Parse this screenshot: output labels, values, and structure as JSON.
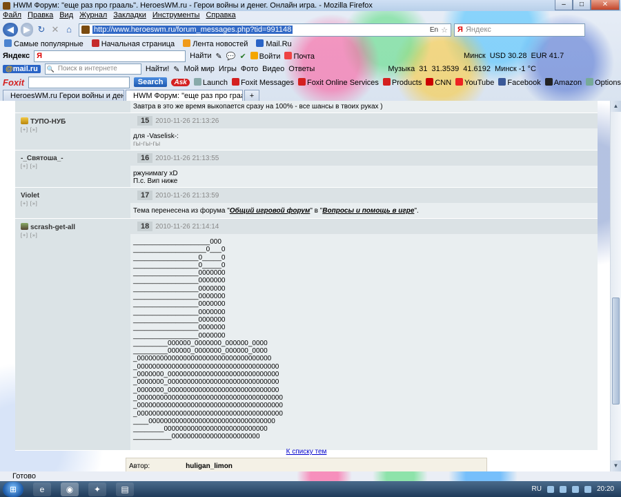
{
  "window": {
    "title": "HWM Форум: \"еще раз про грааль\". HeroesWM.ru - Герои войны и денег. Онлайн игра. - Mozilla Firefox",
    "min": "‒",
    "max": "□",
    "close": "✕"
  },
  "menu": [
    "Файл",
    "Правка",
    "Вид",
    "Журнал",
    "Закладки",
    "Инструменты",
    "Справка"
  ],
  "nav": {
    "url": "http://www.heroeswm.ru/forum_messages.php?tid=991148",
    "lang": "En",
    "search_placeholder": "Яндекс",
    "search_logo": "Я"
  },
  "bookmarks": [
    "Самые популярные",
    "Начальная страница",
    "Лента новостей",
    "Mail.Ru"
  ],
  "yandex_bar": {
    "brand": "Яндекс",
    "input_logo": "Я",
    "find": "Найти",
    "login": "Войти",
    "mail": "Почта",
    "city": "Минск",
    "usd": "USD 30.28",
    "eur": "EUR 41.7"
  },
  "mail_bar": {
    "brand_a": "@",
    "brand_b": "mail.ru",
    "search_placeholder": "Поиск в интернете",
    "find": "Найти!",
    "items": [
      "Мой мир",
      "Игры",
      "Фото",
      "Видео",
      "Ответы"
    ],
    "music": "Музыка",
    "count": "31",
    "rate1": "31.3539",
    "rate2": "41.6192",
    "weather": "Минск -1 °C"
  },
  "foxit_bar": {
    "brand": "Foxit",
    "search": "Search",
    "ask": "Ask",
    "items": [
      "Launch",
      "Foxit Messages",
      "Foxit Online Services",
      "Products",
      "CNN",
      "YouTube",
      "Facebook",
      "Amazon",
      "Options"
    ]
  },
  "tabs": [
    {
      "label": "HeroesWM.ru Герои войны и дене..."
    },
    {
      "label": "HWM Форум: \"еще раз про грааль\" ..."
    }
  ],
  "forum": {
    "prev_tail": "Завтра в это же время выкопается сразу на 100% - все шансы в твоих руках )",
    "author_links": "[+] [»]",
    "posts": [
      {
        "author": "ТУПО-НУБ",
        "num": "15",
        "time": "2010-11-26 21:13:26",
        "lines": [
          "для -Vaselisk-:"
        ],
        "quote": "гы-гы-гы"
      },
      {
        "author": "-_Святоша_-",
        "num": "16",
        "time": "2010-11-26 21:13:55",
        "lines": [
          "ржунимагу xD",
          "П.с. Вип ниже"
        ]
      },
      {
        "author": "Violet",
        "num": "17",
        "time": "2010-11-26 21:13:59",
        "moved_a": "Тема перенесена из форума \"",
        "moved_link1": "Общий игровой форум",
        "moved_b": "\" в \"",
        "moved_link2": "Вопросы и помощь в игре",
        "moved_c": "\"."
      },
      {
        "author": "scrash-get-all",
        "num": "18",
        "time": "2010-11-26 21:14:14",
        "art": [
          "____________________000",
          "___________________0___0",
          "_________________0_____0",
          "_________________0_____0",
          "_________________0000000",
          "_________________0000000",
          "_________________0000000",
          "_________________0000000",
          "_________________0000000",
          "_________________0000000",
          "_________________0000000",
          "_________________0000000",
          "_________________0000000",
          "_________000000_0000000_000000_0000",
          "_________000000_0000000_000000_0000",
          "_00000000000000000000000000000000000",
          "_0000000000000000000000000000000000000",
          "_0000000_00000000000000000000000000000",
          "_0000000_00000000000000000000000000000",
          "_0000000_00000000000000000000000000000",
          "_00000000000000000000000000000000000000",
          "_00000000000000000000000000000000000000",
          "_00000000000000000000000000000000000000",
          "____000000000000000000000000000000000",
          "________000000000000000000000000000",
          "__________00000000000000000000000"
        ]
      }
    ],
    "back_link": "К списку тем",
    "author_label": "Автор:",
    "author_value": "huligan_limon"
  },
  "status": "Готово",
  "taskbar": {
    "lang": "RU",
    "clock": "20:20"
  }
}
